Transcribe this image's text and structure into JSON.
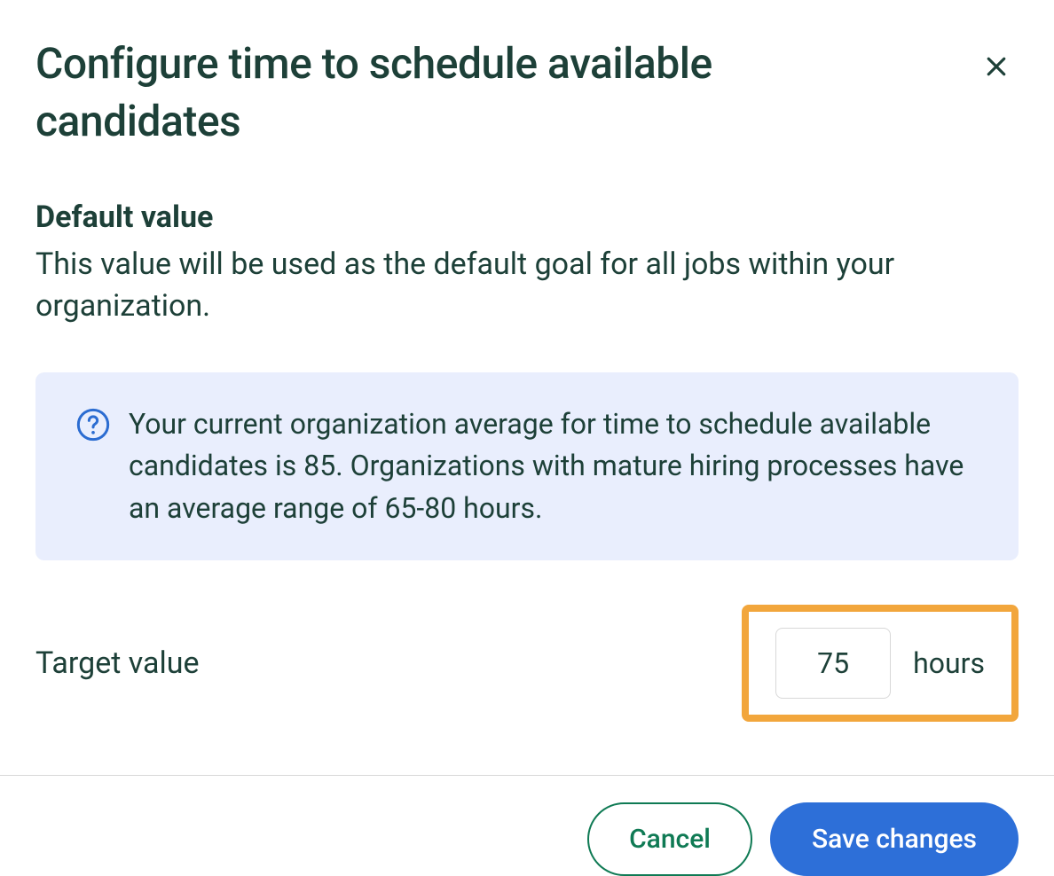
{
  "header": {
    "title": "Configure time to schedule available candidates"
  },
  "section": {
    "heading": "Default value",
    "description": "This value will be used as the default goal for all jobs within your organization."
  },
  "info": {
    "text": "Your current organization average for time to schedule available candidates is 85. Organizations with mature hiring processes have an average range of 65-80 hours."
  },
  "target": {
    "label": "Target value",
    "value": "75",
    "unit": "hours"
  },
  "footer": {
    "cancel": "Cancel",
    "save": "Save changes"
  },
  "colors": {
    "text_primary": "#1d4038",
    "info_bg": "#e9eefd",
    "highlight_border": "#f2a63c",
    "btn_primary_bg": "#2d6fd8",
    "btn_secondary_border": "#0f7a54",
    "info_icon_stroke": "#2b6cd1"
  }
}
